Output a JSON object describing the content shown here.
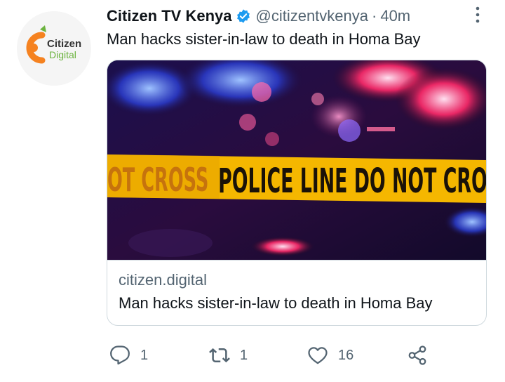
{
  "tweet": {
    "display_name": "Citizen TV Kenya",
    "handle": "@citizentvkenya",
    "separator": "·",
    "time": "40m",
    "text": "Man hacks sister-in-law to death in Homa Bay",
    "avatar": {
      "line1": "Citizen",
      "line2": "Digital"
    }
  },
  "card": {
    "image_text_left": "OT CROSS",
    "image_text_main": "POLICE LINE DO NOT CROSS",
    "domain": "citizen.digital",
    "title": "Man hacks sister-in-law to death in Homa Bay"
  },
  "actions": {
    "reply_count": "1",
    "retweet_count": "1",
    "like_count": "16"
  },
  "colors": {
    "verified": "#1d9bf0",
    "muted": "#536471",
    "tape": "#f5b700",
    "logo_orange": "#f58220",
    "logo_green": "#6cb33f"
  }
}
